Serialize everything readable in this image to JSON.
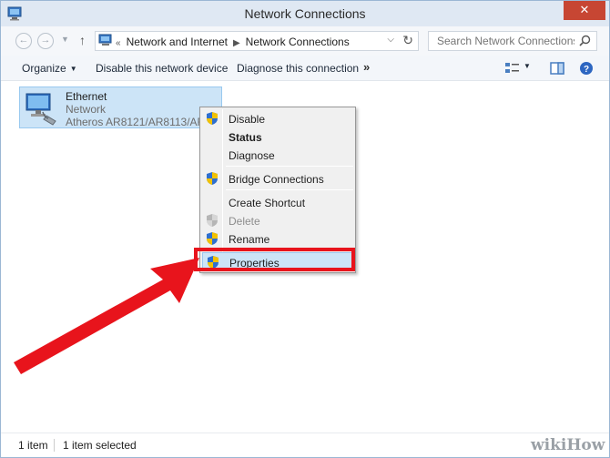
{
  "window": {
    "title": "Network Connections",
    "close_symbol": "✕"
  },
  "address": {
    "overflow_symbol": "«",
    "crumbs": [
      "Network and Internet",
      "Network Connections"
    ],
    "search_placeholder": "Search Network Connections"
  },
  "commandbar": {
    "organize": "Organize",
    "disable_device": "Disable this network device",
    "diagnose": "Diagnose this connection",
    "more": "»"
  },
  "item": {
    "name": "Ethernet",
    "type": "Network",
    "adapter": "Atheros AR8121/AR8113/AR8114 PCI-E Ethernet Controller"
  },
  "context_menu": {
    "items": [
      {
        "label": "Disable",
        "shield": true,
        "bold": false,
        "disabled": false
      },
      {
        "label": "Status",
        "shield": false,
        "bold": true,
        "disabled": false
      },
      {
        "label": "Diagnose",
        "shield": false,
        "bold": false,
        "disabled": false
      },
      {
        "label": "Bridge Connections",
        "shield": true,
        "bold": false,
        "disabled": false
      },
      {
        "label": "Create Shortcut",
        "shield": false,
        "bold": false,
        "disabled": false
      },
      {
        "label": "Delete",
        "shield": true,
        "bold": false,
        "disabled": true
      },
      {
        "label": "Rename",
        "shield": true,
        "bold": false,
        "disabled": false
      },
      {
        "label": "Properties",
        "shield": true,
        "bold": false,
        "disabled": false,
        "highlighted": true
      }
    ]
  },
  "statusbar": {
    "count": "1 item",
    "selected": "1 item selected"
  },
  "colors": {
    "highlight_box": "#e8141c",
    "arrow": "#e8141c",
    "selection": "#cce4f7",
    "close_button": "#c74633"
  },
  "watermark": {
    "text": "wikiHow"
  }
}
